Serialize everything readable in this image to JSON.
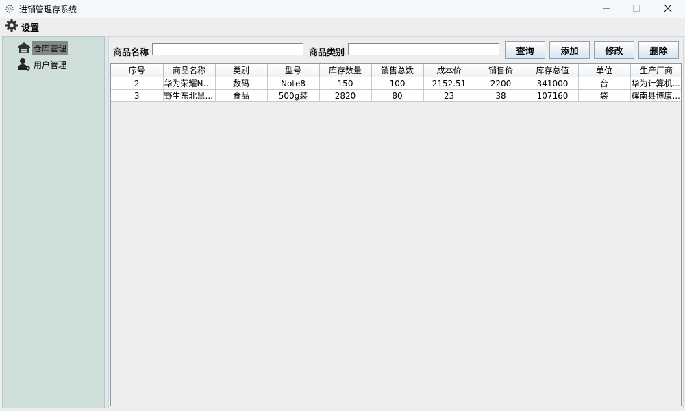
{
  "window": {
    "title": "进销管理存系统",
    "icons": {
      "app": "app-gear-icon",
      "minimize": "minimize-icon",
      "maximize": "maximize-icon",
      "close": "close-icon"
    }
  },
  "menu": {
    "settings_label": "设置",
    "settings_icon": "gear-icon"
  },
  "tree": {
    "items": [
      {
        "label": "仓库管理",
        "icon": "warehouse-icon",
        "selected": true
      },
      {
        "label": "用户管理",
        "icon": "user-settings-icon",
        "selected": false
      }
    ]
  },
  "search": {
    "name_label": "商品名称",
    "name_value": "",
    "category_label": "商品类别",
    "category_value": ""
  },
  "buttons": {
    "query": "查询",
    "add": "添加",
    "edit": "修改",
    "delete": "删除"
  },
  "table": {
    "columns": [
      "序号",
      "商品名称",
      "类别",
      "型号",
      "库存数量",
      "销售总数",
      "成本价",
      "销售价",
      "库存总值",
      "单位",
      "生产厂商"
    ],
    "rows": [
      [
        "2",
        "华为荣耀No...",
        "数码",
        "Note8",
        "150",
        "100",
        "2152.51",
        "2200",
        "341000",
        "台",
        "华为计算机..."
      ],
      [
        "3",
        "野生东北黑...",
        "食品",
        "500g装",
        "2820",
        "80",
        "23",
        "38",
        "107160",
        "袋",
        "辉南县博康..."
      ]
    ]
  },
  "colors": {
    "tree_bg": "#cfdfdc",
    "title_bg": "#f3f8fb",
    "selected_bg": "#848888"
  }
}
